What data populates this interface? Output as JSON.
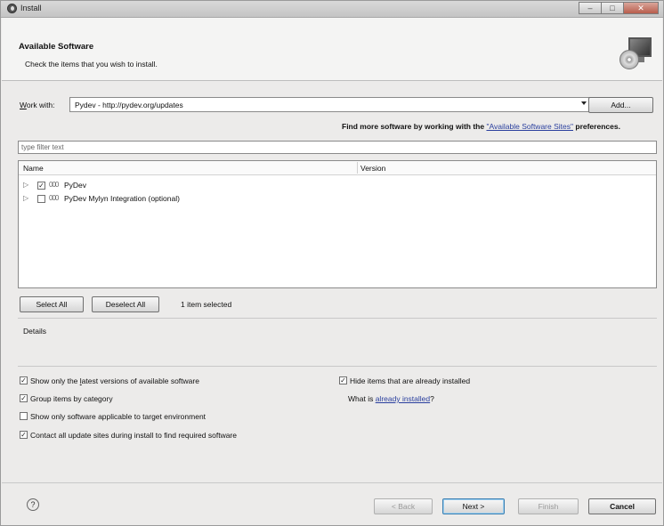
{
  "window": {
    "title": "Install"
  },
  "header": {
    "title": "Available Software",
    "subtitle": "Check the items that you wish to install.",
    "icon": "monitor-cd-icon"
  },
  "work_with": {
    "label_pre": "W",
    "label_post": "ork with:",
    "value": "Pydev - http://pydev.org/updates",
    "add_button": "Add...",
    "find_more_pre": "Find more software by working with the ",
    "sites_link": "\"Available Software Sites\"",
    "find_more_post": " preferences."
  },
  "filter": {
    "placeholder": "type filter text"
  },
  "tree": {
    "columns": [
      "Name",
      "Version"
    ],
    "items": [
      {
        "name": "PyDev",
        "checked": true,
        "checkmark": "✓"
      },
      {
        "name": "PyDev Mylyn Integration (optional)",
        "checked": false,
        "checkmark": ""
      }
    ]
  },
  "selection": {
    "select_all": "Select All",
    "deselect_all": "Deselect All",
    "status": "1 item selected"
  },
  "details": {
    "label": "Details"
  },
  "options": {
    "latest_pre": "Show only the ",
    "latest_u": "l",
    "latest_post": "atest versions of available software",
    "group": "Group items by category",
    "applicable": "Show only software applicable to target environment",
    "contact": "Contact all update sites during install to find required software",
    "hide": "Hide items that are already installed",
    "what_is_pre": "What is ",
    "what_is_link": "already installed",
    "what_is_post": "?"
  },
  "footer": {
    "help": "?",
    "back": "< Back",
    "next": "Next >",
    "finish": "Finish",
    "cancel": "Cancel"
  }
}
